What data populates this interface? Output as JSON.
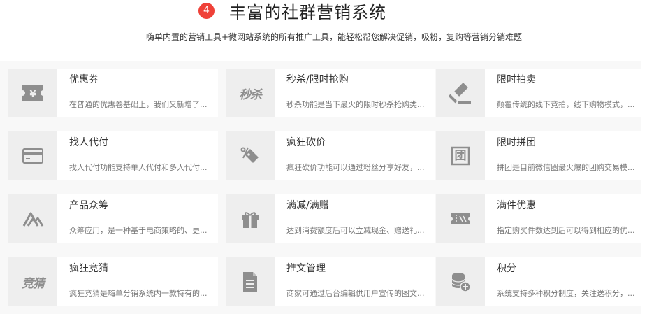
{
  "header": {
    "step_number": "4",
    "title": "丰富的社群营销系统",
    "subtitle": "嗨单内置的营销工具+微网站系统的所有推广工具，能轻松帮您解决促销，吸粉，复购等营销分销难题"
  },
  "features": [
    {
      "icon": "coupon-icon",
      "title": "优惠券",
      "desc": "在普通的优惠卷基础上，我们又新增了..."
    },
    {
      "icon": "flash-sale-icon",
      "icon_text": "秒杀",
      "title": "秒杀/限时抢购",
      "desc": "秒杀功能是当下最火的限时秒杀抢购类..."
    },
    {
      "icon": "auction-gavel-icon",
      "title": "限时拍卖",
      "desc": "颠覆传统的线下竞拍，线下购物模式，..."
    },
    {
      "icon": "card-icon",
      "title": "找人代付",
      "desc": "找人代付功能支持单人代付和多人代付..."
    },
    {
      "icon": "price-tag-icon",
      "title": "疯狂砍价",
      "desc": "疯狂砍价功能可以通过粉丝分享好友，..."
    },
    {
      "icon": "group-buy-icon",
      "icon_text": "团",
      "title": "限时拼团",
      "desc": "拼团是目前微信圈最火爆的团购交易模..."
    },
    {
      "icon": "crowdfunding-icon",
      "title": "产品众筹",
      "desc": "众筹应用，是一种基于电商策略的、更..."
    },
    {
      "icon": "gift-icon",
      "title": "满减/满赠",
      "desc": "达到消费额度后可以立减现金、赠送礼..."
    },
    {
      "icon": "ticket-icon",
      "title": "满件优惠",
      "desc": "指定购买件数达到后可以得到相应的优..."
    },
    {
      "icon": "guess-icon",
      "icon_text": "竞猜",
      "title": "疯狂竞猜",
      "desc": "疯狂竞猜是嗨单分销系统内一款特有的..."
    },
    {
      "icon": "document-icon",
      "title": "推文管理",
      "desc": "商家可通过后台编辑供用户宣传的图文..."
    },
    {
      "icon": "points-coins-icon",
      "title": "积分",
      "desc": "系统支持多种积分制度，关注送积分，..."
    }
  ]
}
